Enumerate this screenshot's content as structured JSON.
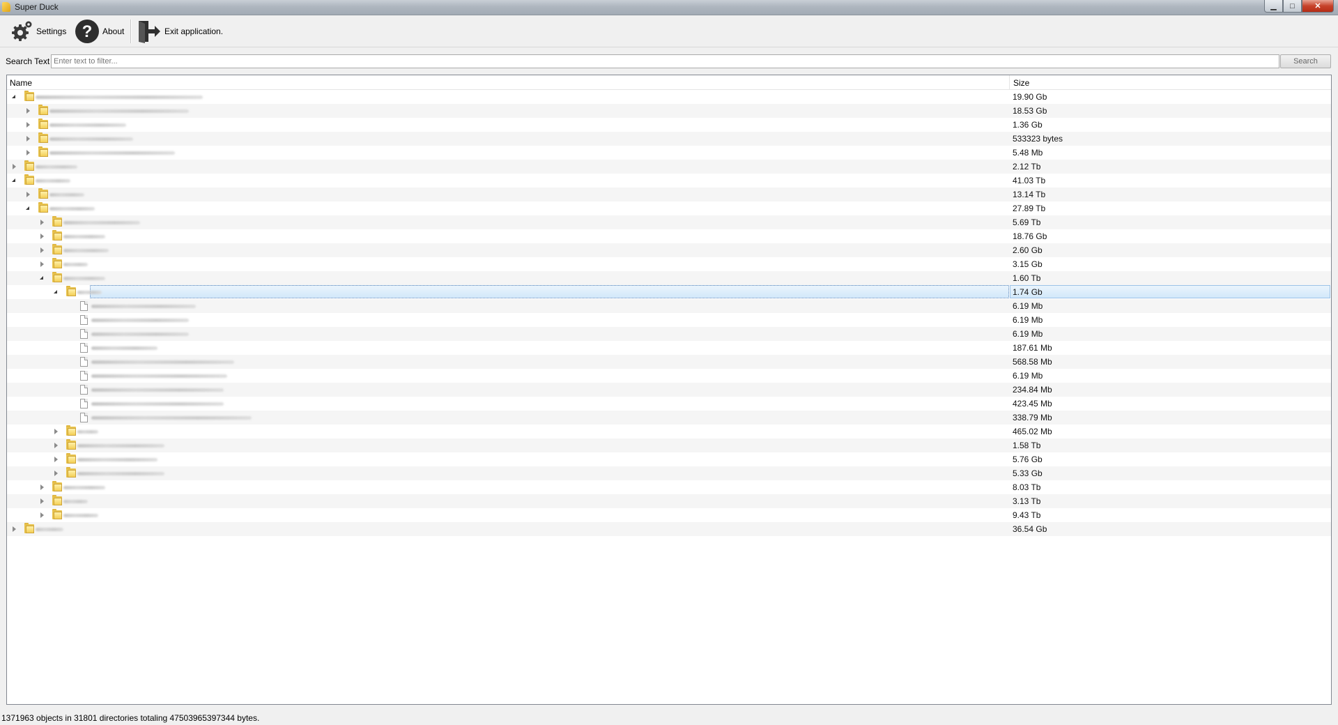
{
  "window": {
    "title": "Super Duck",
    "min_glyph": "▁",
    "max_glyph": "□",
    "close_glyph": "✕"
  },
  "toolbar": {
    "settings_label": "Settings",
    "about_label": "About",
    "exit_label": "Exit application."
  },
  "search": {
    "label": "Search Text",
    "placeholder": "Enter text to filter...",
    "value": "",
    "button_label": "Search"
  },
  "tree": {
    "columns": {
      "name": "Name",
      "size": "Size"
    },
    "rows": [
      {
        "depth": 0,
        "kind": "folder",
        "state": "open",
        "size": "19.90 Gb"
      },
      {
        "depth": 1,
        "kind": "folder",
        "state": "closed",
        "size": "18.53 Gb"
      },
      {
        "depth": 1,
        "kind": "folder",
        "state": "closed",
        "size": "1.36 Gb"
      },
      {
        "depth": 1,
        "kind": "folder",
        "state": "closed",
        "size": "533323 bytes"
      },
      {
        "depth": 1,
        "kind": "folder",
        "state": "closed",
        "size": "5.48 Mb"
      },
      {
        "depth": 0,
        "kind": "folder",
        "state": "closed",
        "size": "2.12 Tb"
      },
      {
        "depth": 0,
        "kind": "folder",
        "state": "open",
        "size": "41.03 Tb"
      },
      {
        "depth": 1,
        "kind": "folder",
        "state": "closed",
        "size": "13.14 Tb"
      },
      {
        "depth": 1,
        "kind": "folder",
        "state": "open",
        "size": "27.89 Tb"
      },
      {
        "depth": 2,
        "kind": "folder",
        "state": "closed",
        "size": "5.69 Tb"
      },
      {
        "depth": 2,
        "kind": "folder",
        "state": "closed",
        "size": "18.76 Gb"
      },
      {
        "depth": 2,
        "kind": "folder",
        "state": "closed",
        "size": "2.60 Gb"
      },
      {
        "depth": 2,
        "kind": "folder",
        "state": "closed",
        "size": "3.15 Gb"
      },
      {
        "depth": 2,
        "kind": "folder",
        "state": "open",
        "size": "1.60 Tb"
      },
      {
        "depth": 3,
        "kind": "folder",
        "state": "open",
        "size": "1.74 Gb",
        "selected": true
      },
      {
        "depth": 4,
        "kind": "file",
        "state": "none",
        "size": "6.19 Mb"
      },
      {
        "depth": 4,
        "kind": "file",
        "state": "none",
        "size": "6.19 Mb"
      },
      {
        "depth": 4,
        "kind": "file",
        "state": "none",
        "size": "6.19 Mb"
      },
      {
        "depth": 4,
        "kind": "file",
        "state": "none",
        "size": "187.61 Mb"
      },
      {
        "depth": 4,
        "kind": "file",
        "state": "none",
        "size": "568.58 Mb"
      },
      {
        "depth": 4,
        "kind": "file",
        "state": "none",
        "size": "6.19 Mb"
      },
      {
        "depth": 4,
        "kind": "file",
        "state": "none",
        "size": "234.84 Mb"
      },
      {
        "depth": 4,
        "kind": "file",
        "state": "none",
        "size": "423.45 Mb"
      },
      {
        "depth": 4,
        "kind": "file",
        "state": "none",
        "size": "338.79 Mb"
      },
      {
        "depth": 3,
        "kind": "folder",
        "state": "closed",
        "size": "465.02 Mb"
      },
      {
        "depth": 3,
        "kind": "folder",
        "state": "closed",
        "size": "1.58 Tb"
      },
      {
        "depth": 3,
        "kind": "folder",
        "state": "closed",
        "size": "5.76 Gb"
      },
      {
        "depth": 3,
        "kind": "folder",
        "state": "closed",
        "size": "5.33 Gb"
      },
      {
        "depth": 2,
        "kind": "folder",
        "state": "closed",
        "size": "8.03 Tb"
      },
      {
        "depth": 2,
        "kind": "folder",
        "state": "closed",
        "size": "3.13 Tb"
      },
      {
        "depth": 2,
        "kind": "folder",
        "state": "closed",
        "size": "9.43 Tb"
      },
      {
        "depth": 0,
        "kind": "folder",
        "state": "closed",
        "size": "36.54 Gb"
      }
    ]
  },
  "status": {
    "text": "1371963 objects in 31801 directories totaling 47503965397344 bytes."
  }
}
